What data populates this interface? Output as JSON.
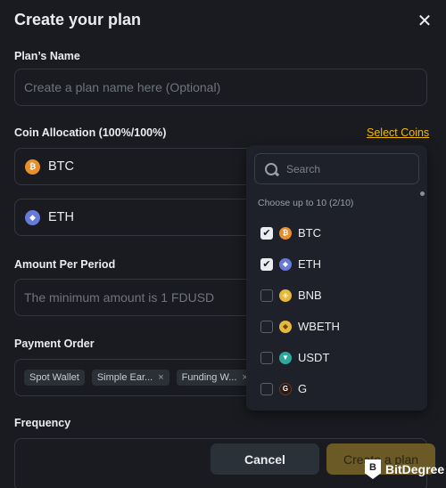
{
  "modal": {
    "title": "Create your plan",
    "close_icon": "close-icon"
  },
  "plan_name": {
    "label": "Plan’s Name",
    "value": "",
    "placeholder": "Create a plan name here (Optional)"
  },
  "coin_allocation": {
    "label": "Coin Allocation (100%/100%)",
    "select_coins_link": "Select Coins",
    "coins": [
      {
        "symbol": "BTC",
        "icon": "bitcoin-icon",
        "color": "#e88f2c"
      },
      {
        "symbol": "ETH",
        "icon": "ethereum-icon",
        "color": "#6779d9"
      }
    ]
  },
  "amount": {
    "label": "Amount Per Period",
    "value": "",
    "placeholder": "The minimum amount is 1 FDUSD"
  },
  "payment_order": {
    "label": "Payment Order",
    "chips": [
      {
        "label": "Spot Wallet",
        "removable": false
      },
      {
        "label": "Simple Ear...",
        "removable": true
      },
      {
        "label": "Funding W...",
        "removable": true
      }
    ],
    "remove_glyph": "×"
  },
  "frequency": {
    "label": "Frequency"
  },
  "coin_dropdown": {
    "search_placeholder": "Search",
    "hint": "Choose up to 10 (2/10)",
    "options": [
      {
        "symbol": "BTC",
        "checked": true,
        "icon": "bitcoin-icon",
        "glyph": "₿"
      },
      {
        "symbol": "ETH",
        "checked": true,
        "icon": "ethereum-icon",
        "glyph": "◆"
      },
      {
        "symbol": "BNB",
        "checked": false,
        "icon": "bnb-icon",
        "glyph": "◈"
      },
      {
        "symbol": "WBETH",
        "checked": false,
        "icon": "wbeth-icon",
        "glyph": "◆"
      },
      {
        "symbol": "USDT",
        "checked": false,
        "icon": "usdt-icon",
        "glyph": "▼"
      },
      {
        "symbol": "G",
        "checked": false,
        "icon": "g-token-icon",
        "glyph": "G"
      }
    ]
  },
  "footer": {
    "cancel_label": "Cancel",
    "create_label": "Create a plan"
  },
  "watermark": {
    "text": "BitDegree",
    "logo_glyph": "B"
  },
  "colors": {
    "background": "#1a1b20",
    "accent": "#f0b90b",
    "create_button_disabled": "#6b5a26",
    "cancel_button": "#2b3139"
  }
}
